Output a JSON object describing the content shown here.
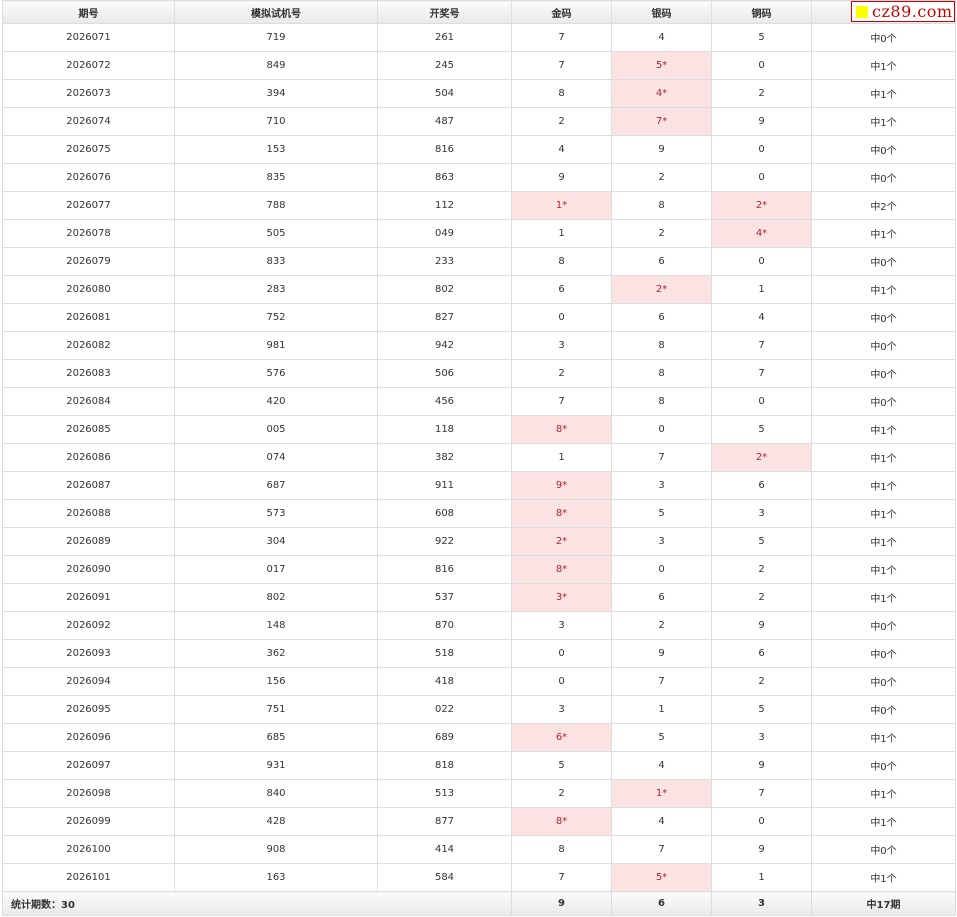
{
  "colors": {
    "hit_bg": "#fbe3e4",
    "hit_text": "#b0262f",
    "header_bg": "#ececec",
    "logo_red": "#cc0000",
    "logo_square": "#ffff00"
  },
  "logo": {
    "text": "cz89.com"
  },
  "headers": [
    "期号",
    "模拟试机号",
    "开奖号",
    "金码",
    "银码",
    "铜码",
    ""
  ],
  "rows": [
    {
      "issue": "2026071",
      "sim": "719",
      "draw": "261",
      "gold": "7",
      "silver": "4",
      "copper": "5",
      "result": "中0个",
      "hit": ""
    },
    {
      "issue": "2026072",
      "sim": "849",
      "draw": "245",
      "gold": "7",
      "silver": "5*",
      "copper": "0",
      "result": "中1个",
      "hit": "silver"
    },
    {
      "issue": "2026073",
      "sim": "394",
      "draw": "504",
      "gold": "8",
      "silver": "4*",
      "copper": "2",
      "result": "中1个",
      "hit": "silver"
    },
    {
      "issue": "2026074",
      "sim": "710",
      "draw": "487",
      "gold": "2",
      "silver": "7*",
      "copper": "9",
      "result": "中1个",
      "hit": "silver"
    },
    {
      "issue": "2026075",
      "sim": "153",
      "draw": "816",
      "gold": "4",
      "silver": "9",
      "copper": "0",
      "result": "中0个",
      "hit": ""
    },
    {
      "issue": "2026076",
      "sim": "835",
      "draw": "863",
      "gold": "9",
      "silver": "2",
      "copper": "0",
      "result": "中0个",
      "hit": ""
    },
    {
      "issue": "2026077",
      "sim": "788",
      "draw": "112",
      "gold": "1*",
      "silver": "8",
      "copper": "2*",
      "result": "中2个",
      "hit": "gold copper"
    },
    {
      "issue": "2026078",
      "sim": "505",
      "draw": "049",
      "gold": "1",
      "silver": "2",
      "copper": "4*",
      "result": "中1个",
      "hit": "copper"
    },
    {
      "issue": "2026079",
      "sim": "833",
      "draw": "233",
      "gold": "8",
      "silver": "6",
      "copper": "0",
      "result": "中0个",
      "hit": ""
    },
    {
      "issue": "2026080",
      "sim": "283",
      "draw": "802",
      "gold": "6",
      "silver": "2*",
      "copper": "1",
      "result": "中1个",
      "hit": "silver"
    },
    {
      "issue": "2026081",
      "sim": "752",
      "draw": "827",
      "gold": "0",
      "silver": "6",
      "copper": "4",
      "result": "中0个",
      "hit": ""
    },
    {
      "issue": "2026082",
      "sim": "981",
      "draw": "942",
      "gold": "3",
      "silver": "8",
      "copper": "7",
      "result": "中0个",
      "hit": ""
    },
    {
      "issue": "2026083",
      "sim": "576",
      "draw": "506",
      "gold": "2",
      "silver": "8",
      "copper": "7",
      "result": "中0个",
      "hit": ""
    },
    {
      "issue": "2026084",
      "sim": "420",
      "draw": "456",
      "gold": "7",
      "silver": "8",
      "copper": "0",
      "result": "中0个",
      "hit": ""
    },
    {
      "issue": "2026085",
      "sim": "005",
      "draw": "118",
      "gold": "8*",
      "silver": "0",
      "copper": "5",
      "result": "中1个",
      "hit": "gold"
    },
    {
      "issue": "2026086",
      "sim": "074",
      "draw": "382",
      "gold": "1",
      "silver": "7",
      "copper": "2*",
      "result": "中1个",
      "hit": "copper"
    },
    {
      "issue": "2026087",
      "sim": "687",
      "draw": "911",
      "gold": "9*",
      "silver": "3",
      "copper": "6",
      "result": "中1个",
      "hit": "gold"
    },
    {
      "issue": "2026088",
      "sim": "573",
      "draw": "608",
      "gold": "8*",
      "silver": "5",
      "copper": "3",
      "result": "中1个",
      "hit": "gold"
    },
    {
      "issue": "2026089",
      "sim": "304",
      "draw": "922",
      "gold": "2*",
      "silver": "3",
      "copper": "5",
      "result": "中1个",
      "hit": "gold"
    },
    {
      "issue": "2026090",
      "sim": "017",
      "draw": "816",
      "gold": "8*",
      "silver": "0",
      "copper": "2",
      "result": "中1个",
      "hit": "gold"
    },
    {
      "issue": "2026091",
      "sim": "802",
      "draw": "537",
      "gold": "3*",
      "silver": "6",
      "copper": "2",
      "result": "中1个",
      "hit": "gold"
    },
    {
      "issue": "2026092",
      "sim": "148",
      "draw": "870",
      "gold": "3",
      "silver": "2",
      "copper": "9",
      "result": "中0个",
      "hit": ""
    },
    {
      "issue": "2026093",
      "sim": "362",
      "draw": "518",
      "gold": "0",
      "silver": "9",
      "copper": "6",
      "result": "中0个",
      "hit": ""
    },
    {
      "issue": "2026094",
      "sim": "156",
      "draw": "418",
      "gold": "0",
      "silver": "7",
      "copper": "2",
      "result": "中0个",
      "hit": ""
    },
    {
      "issue": "2026095",
      "sim": "751",
      "draw": "022",
      "gold": "3",
      "silver": "1",
      "copper": "5",
      "result": "中0个",
      "hit": ""
    },
    {
      "issue": "2026096",
      "sim": "685",
      "draw": "689",
      "gold": "6*",
      "silver": "5",
      "copper": "3",
      "result": "中1个",
      "hit": "gold"
    },
    {
      "issue": "2026097",
      "sim": "931",
      "draw": "818",
      "gold": "5",
      "silver": "4",
      "copper": "9",
      "result": "中0个",
      "hit": ""
    },
    {
      "issue": "2026098",
      "sim": "840",
      "draw": "513",
      "gold": "2",
      "silver": "1*",
      "copper": "7",
      "result": "中1个",
      "hit": "silver"
    },
    {
      "issue": "2026099",
      "sim": "428",
      "draw": "877",
      "gold": "8*",
      "silver": "4",
      "copper": "0",
      "result": "中1个",
      "hit": "gold"
    },
    {
      "issue": "2026100",
      "sim": "908",
      "draw": "414",
      "gold": "8",
      "silver": "7",
      "copper": "9",
      "result": "中0个",
      "hit": ""
    },
    {
      "issue": "2026101",
      "sim": "163",
      "draw": "584",
      "gold": "7",
      "silver": "5*",
      "copper": "1",
      "result": "中1个",
      "hit": "silver"
    }
  ],
  "footer": {
    "label": "统计期数：30",
    "gold": "9",
    "silver": "6",
    "copper": "3",
    "total": "中17期"
  }
}
